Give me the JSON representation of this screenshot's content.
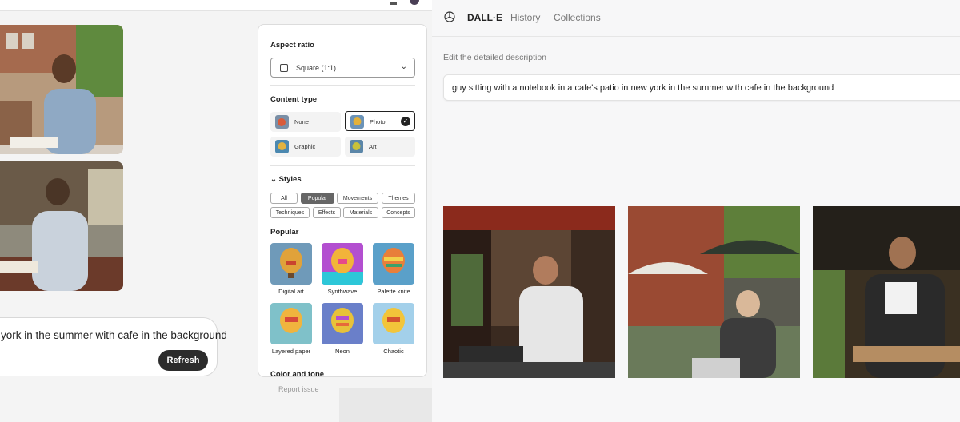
{
  "left_panel": {
    "prompt": {
      "text": "york in the summer with cafe in the background",
      "refresh_label": "Refresh"
    },
    "report_issue": "Report issue",
    "sidebar": {
      "aspect_ratio": {
        "title": "Aspect ratio",
        "selected": "Square (1:1)"
      },
      "content_type": {
        "title": "Content type",
        "options": [
          "None",
          "Photo",
          "Graphic",
          "Art"
        ],
        "selected": "Photo"
      },
      "styles": {
        "title": "Styles",
        "tabs": [
          "All",
          "Popular",
          "Movements",
          "Themes",
          "Techniques",
          "Effects",
          "Materials",
          "Concepts"
        ],
        "active_tab": "Popular"
      },
      "popular": {
        "title": "Popular",
        "items": [
          "Digital art",
          "Synthwave",
          "Palette knife",
          "Layered paper",
          "Neon",
          "Chaotic"
        ]
      },
      "color_and_tone": {
        "title": "Color and tone"
      }
    }
  },
  "right_panel": {
    "brand": "DALL·E",
    "nav": [
      "History",
      "Collections"
    ],
    "edit_label": "Edit the detailed description",
    "description": "guy sitting with a notebook in a cafe's patio in new york in the summer with cafe in the background"
  },
  "colors": {
    "dark_button": "#2c2c2c",
    "chip_active": "#666666",
    "panel_bg": "#f7f7f8"
  }
}
